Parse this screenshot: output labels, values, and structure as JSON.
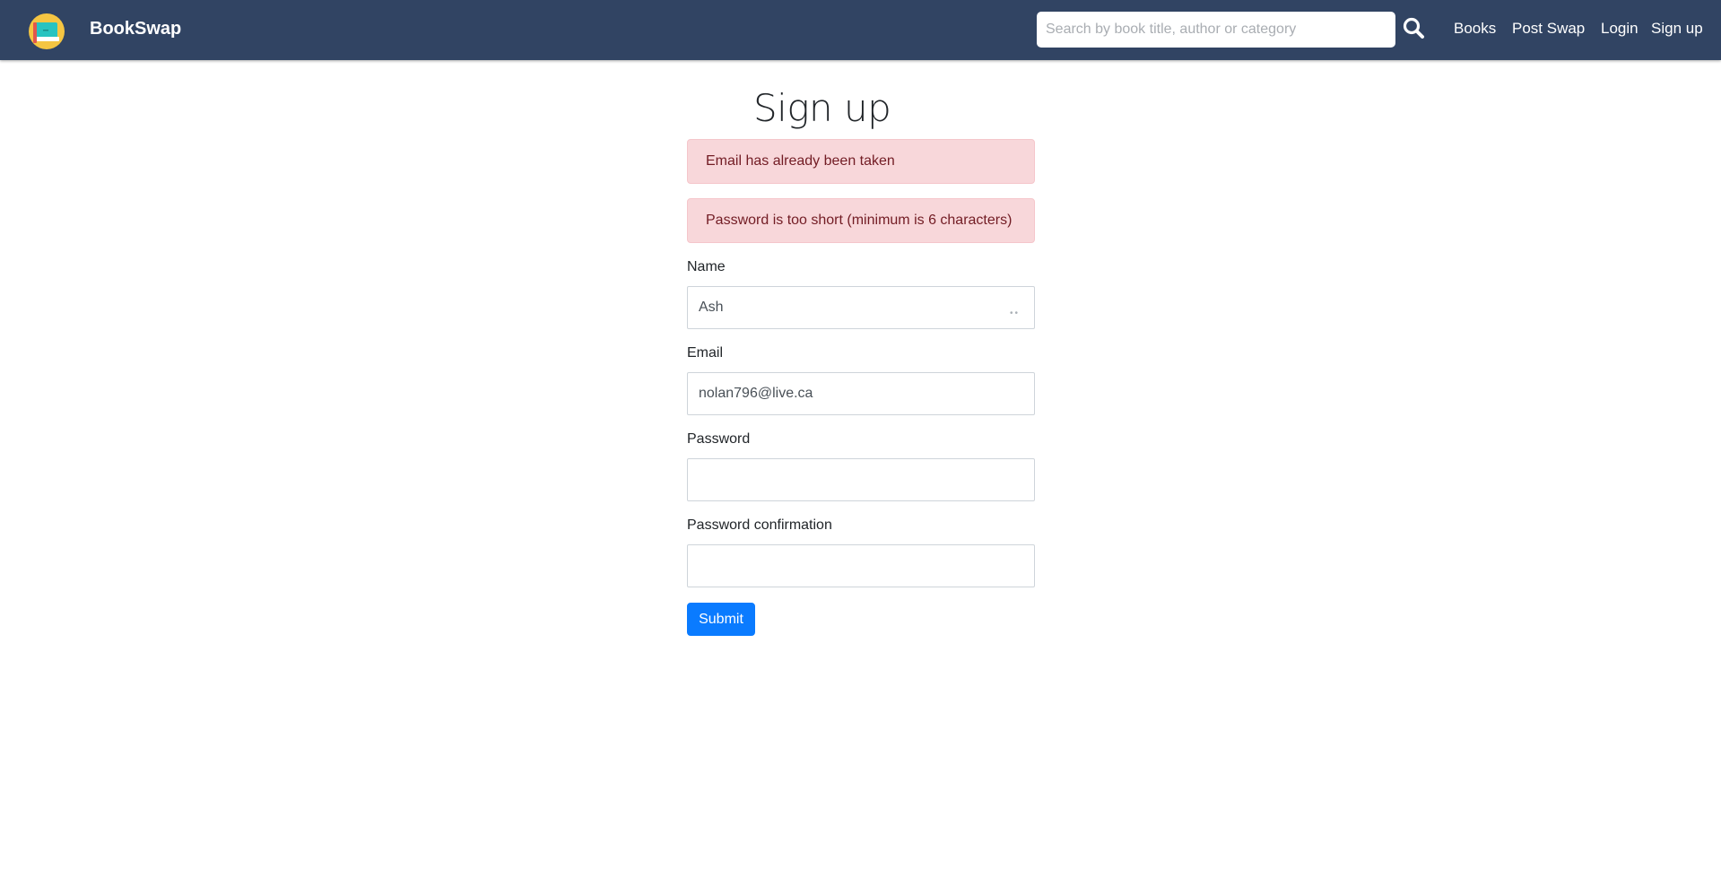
{
  "navbar": {
    "brand": "BookSwap",
    "search_placeholder": "Search by book title, author or category",
    "links": {
      "books": "Books",
      "post_swap": "Post Swap",
      "login": "Login",
      "signup": "Sign up"
    },
    "colors": {
      "background": "#314463",
      "text": "#ffffff"
    }
  },
  "page": {
    "title": "Sign up"
  },
  "errors": [
    "Email has already been taken",
    "Password is too short (minimum is 6 characters)"
  ],
  "form": {
    "name_label": "Name",
    "name_value": "Ash",
    "email_label": "Email",
    "email_value": "nolan796@live.ca",
    "password_label": "Password",
    "password_value": "",
    "password_confirmation_label": "Password confirmation",
    "password_confirmation_value": "",
    "submit_label": "Submit"
  },
  "colors": {
    "alert_background": "#f8d7da",
    "alert_text": "#721c24",
    "primary_button": "#0a7bff"
  },
  "icons": {
    "logo": "book-logo-icon",
    "search": "search-icon"
  }
}
